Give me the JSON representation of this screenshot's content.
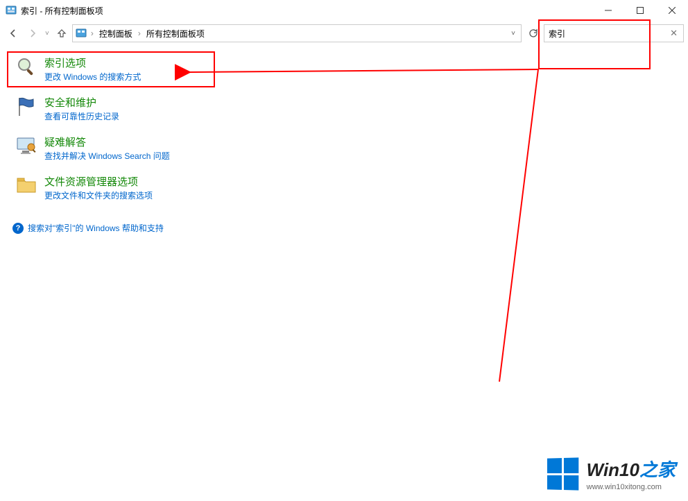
{
  "title": "索引 - 所有控制面板项",
  "breadcrumb": {
    "root": "控制面板",
    "current": "所有控制面板项"
  },
  "search": {
    "value": "索引"
  },
  "results": [
    {
      "title": "索引选项",
      "desc": "更改 Windows 的搜索方式",
      "icon": "magnifier"
    },
    {
      "title": "安全和维护",
      "desc": "查看可靠性历史记录",
      "icon": "flag"
    },
    {
      "title": "疑难解答",
      "desc": "查找并解决 Windows Search 问题",
      "icon": "monitor"
    },
    {
      "title": "文件资源管理器选项",
      "desc": "更改文件和文件夹的搜索选项",
      "icon": "folder"
    }
  ],
  "helpline": "搜索对\"索引\"的 Windows 帮助和支持",
  "watermark": {
    "brand_prefix": "Win10",
    "brand_suffix": "之家",
    "url": "www.win10xitong.com"
  }
}
